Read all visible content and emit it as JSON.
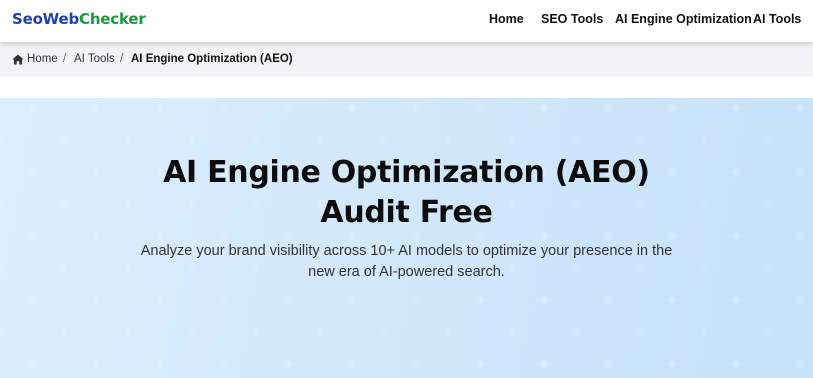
{
  "header": {
    "logo_part_a": "SeoWeb",
    "logo_part_b": "Checker",
    "nav": [
      "Home",
      "SEO Tools",
      "AI Engine Optimization",
      "AI Tools"
    ]
  },
  "breadcrumb": {
    "home": "Home",
    "separator": "/",
    "items": [
      "AI Tools",
      "AI Engine Optimization (AEO)"
    ]
  },
  "hero": {
    "title_line_1": "AI Engine Optimization (AEO)",
    "title_line_2": "Audit Free",
    "subtitle_line_1": "Analyze your brand visibility across 10+ AI models to optimize your presence in the",
    "subtitle_line_2": "new era of AI-powered search."
  },
  "colors": {
    "logo_blue": "#1f3fb3",
    "logo_green": "#1a9a3c",
    "hero_background": "#d2e8fb",
    "breadcrumb_background": "#f3f3f5"
  },
  "icons": {
    "breadcrumb_home": "home-icon"
  }
}
